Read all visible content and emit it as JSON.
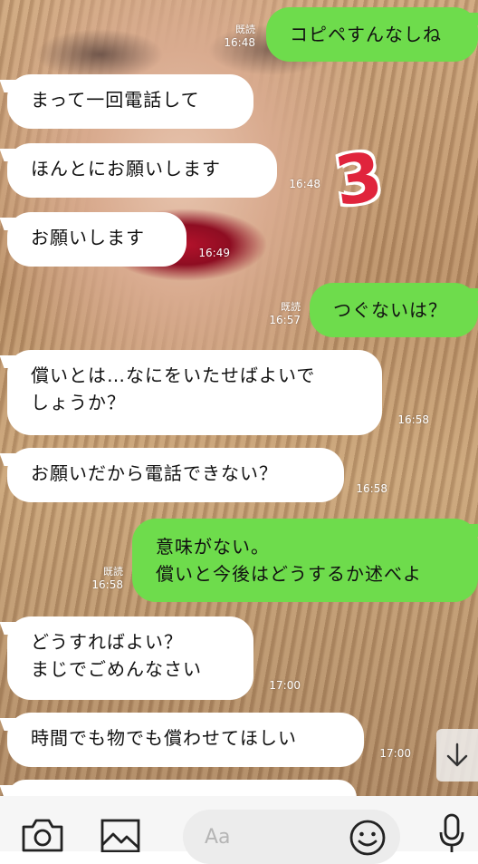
{
  "conversation": {
    "messages": [
      {
        "side": "right",
        "text": "コピペすんなしね",
        "status": "既読",
        "time": "16:48"
      },
      {
        "side": "left",
        "text": "まって一回電話して",
        "time": ""
      },
      {
        "side": "left",
        "text": "ほんとにお願いします",
        "time": "16:48"
      },
      {
        "side": "left",
        "text": "お願いします",
        "time": "16:49"
      },
      {
        "side": "right",
        "text": "つぐないは？",
        "status": "既読",
        "time": "16:57"
      },
      {
        "side": "left",
        "lines": [
          "償いとは…なにをいたせばよいで",
          "しょうか？"
        ],
        "time": "16:58"
      },
      {
        "side": "left",
        "text": "お願いだから電話できない？",
        "time": "16:58"
      },
      {
        "side": "right",
        "lines": [
          "意味がない。",
          "償いと今後はどうするか述べよ"
        ],
        "status": "既読",
        "time": "16:58"
      },
      {
        "side": "left",
        "lines": [
          "どうすればよい？",
          "まじでごめんなさい"
        ],
        "time": "17:00"
      },
      {
        "side": "left",
        "text": "時間でも物でも償わせてほしい",
        "time": "17:00"
      }
    ]
  },
  "sticker": {
    "text": "3",
    "color": "#e0243c"
  },
  "composer": {
    "placeholder": "Aa",
    "camera_icon": "camera-icon",
    "image_icon": "image-icon",
    "emoji_icon": "emoji-icon",
    "mic_icon": "microphone-icon"
  },
  "scroll_button": {
    "icon": "arrow-down-icon"
  },
  "colors": {
    "sent_bubble": "#6edc4c",
    "received_bubble": "#ffffff",
    "sticker": "#e0243c"
  }
}
